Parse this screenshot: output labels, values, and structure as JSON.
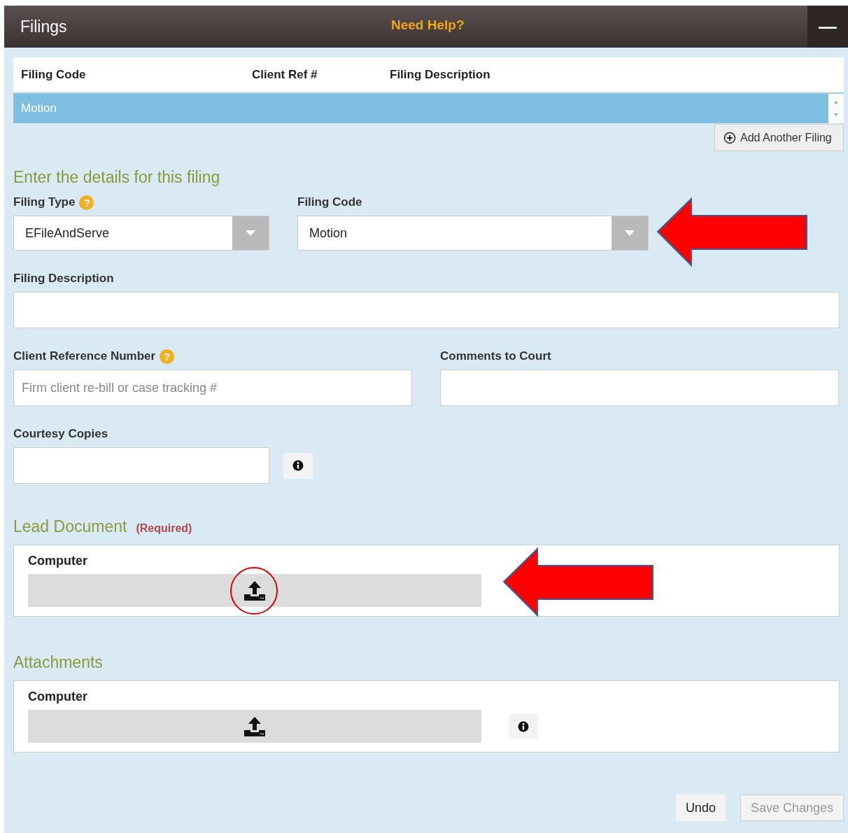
{
  "header": {
    "title": "Filings",
    "help_link": "Need Help?",
    "collapse_button": "—"
  },
  "filings_table": {
    "columns": [
      "Filing Code",
      "Client Ref #",
      "Filing Description"
    ],
    "rows": [
      {
        "cells": [
          "Motion",
          "",
          ""
        ],
        "selected": true
      }
    ],
    "add_button": "Add Another Filing"
  },
  "details": {
    "title": "Enter the details for this filing",
    "filing_type": {
      "label": "Filing Type",
      "help": "?",
      "value": "EFileAndServe"
    },
    "filing_code": {
      "label": "Filing Code",
      "value": "Motion"
    },
    "filing_description": {
      "label": "Filing Description"
    },
    "client_reference": {
      "label": "Client Reference Number",
      "help": "?",
      "placeholder": "Firm client re-bill or case tracking #"
    },
    "comments": {
      "label": "Comments to Court"
    },
    "courtesy_copies": {
      "label": "Courtesy Copies"
    }
  },
  "lead_document": {
    "title": "Lead Document",
    "note": "(Required)",
    "source_label": "Computer"
  },
  "attachments": {
    "title": "Attachments",
    "source_label": "Computer"
  },
  "buttons": [
    {
      "label": "Undo",
      "disabled": false
    },
    {
      "label": "Save Changes",
      "disabled": true
    }
  ]
}
